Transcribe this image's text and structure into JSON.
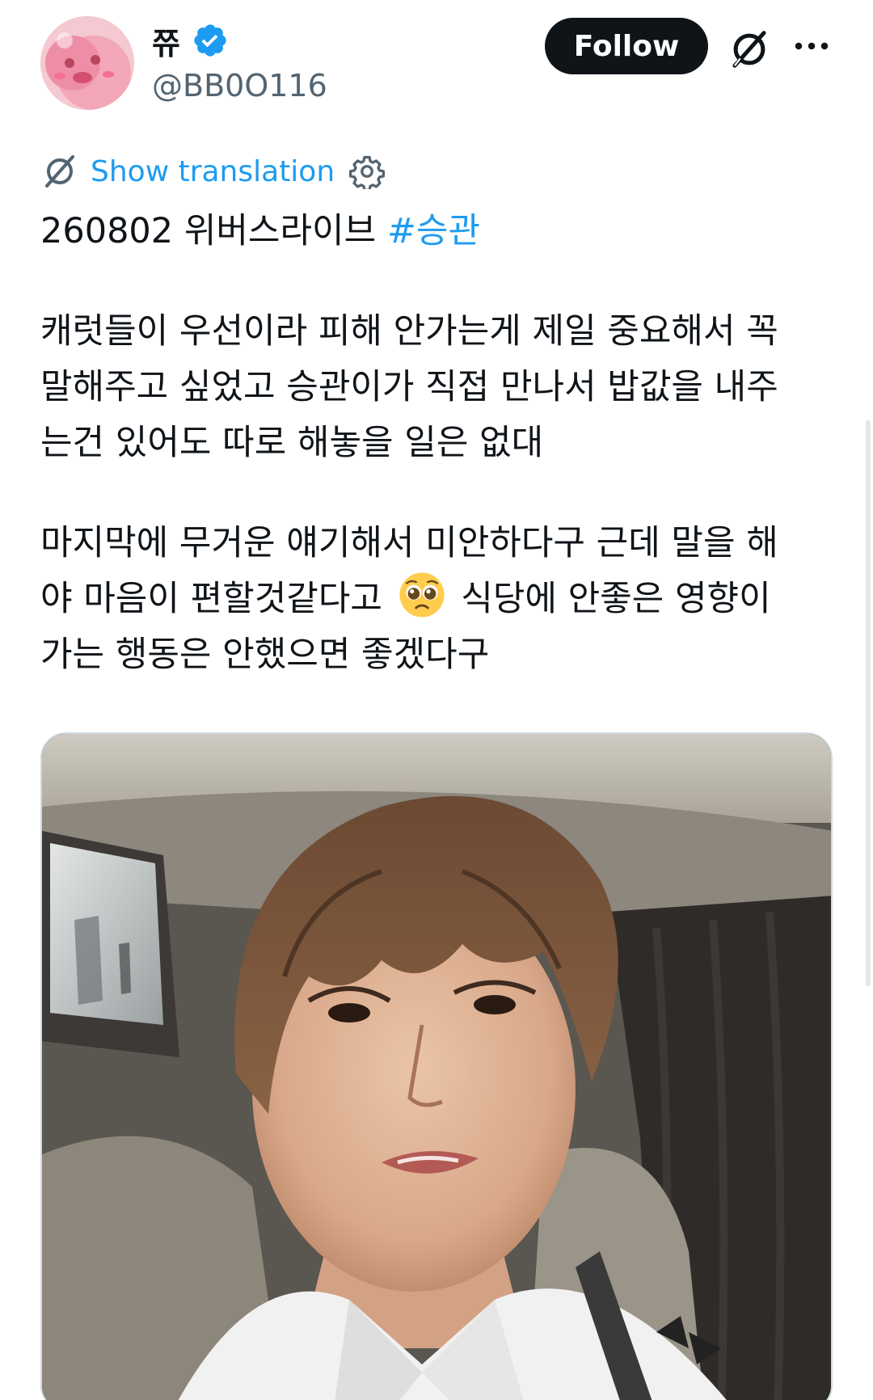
{
  "author": {
    "display_name": "쮸",
    "handle": "@BB0O116",
    "verified": true,
    "avatar_icon": "pink-character-avatar"
  },
  "actions": {
    "follow_label": "Follow",
    "grok_icon": "grok-icon",
    "more_icon": "more-horizontal-icon"
  },
  "translation": {
    "label": "Show translation",
    "icon": "grok-icon",
    "settings_icon": "gear-icon"
  },
  "tweet": {
    "line1_text": "260802 위버스라이브 ",
    "hashtag": "#승관",
    "para1": [
      "캐럿들이 우선이라 피해 안가는게 제일 중요해서 꼭",
      "말해주고 싶었고 승관이가 직접 만나서 밥값을 내주",
      "는건 있어도 따로 해놓을 일은 없대"
    ],
    "para2_line1": "마지막에 무거운 얘기해서 미안하다구 근데 말을 해",
    "para2_line2_before": "야 마음이 편할것같다고 ",
    "para2_emoji": "pleading-face-emoji",
    "para2_line2_after": " 식당에 안좋은 영향이",
    "para2_line3": "가는 행동은 안했으면 좋겠다구"
  },
  "media": {
    "type": "video-still",
    "description_icon": "livestream-photo"
  },
  "colors": {
    "accent": "#1d9bf0",
    "text": "#0f1419",
    "secondary": "#536471",
    "follow_bg": "#0f1419"
  }
}
